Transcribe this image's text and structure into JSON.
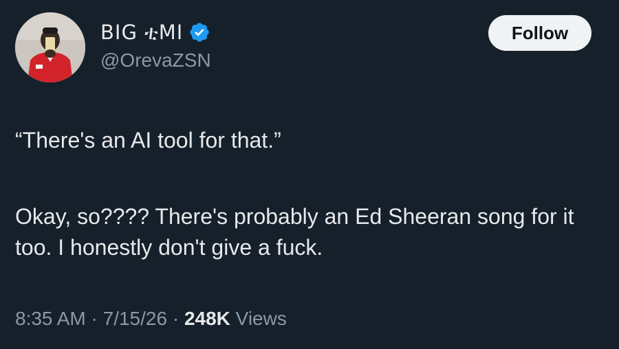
{
  "author": {
    "display_name": "BIG ቲMI",
    "handle": "@OrevaZSN",
    "verified": true,
    "verified_color": "#1d9bf0"
  },
  "follow_label": "Follow",
  "tweet": {
    "quote_line": "“There's an AI tool for that.”",
    "body_line": "Okay, so???? There's probably an Ed Sheeran song for it too. I honestly don't give a fuck."
  },
  "meta": {
    "time": "8:35 AM",
    "date": "7/15/26",
    "views_count": "248K",
    "views_label": "Views",
    "separator": "·"
  }
}
